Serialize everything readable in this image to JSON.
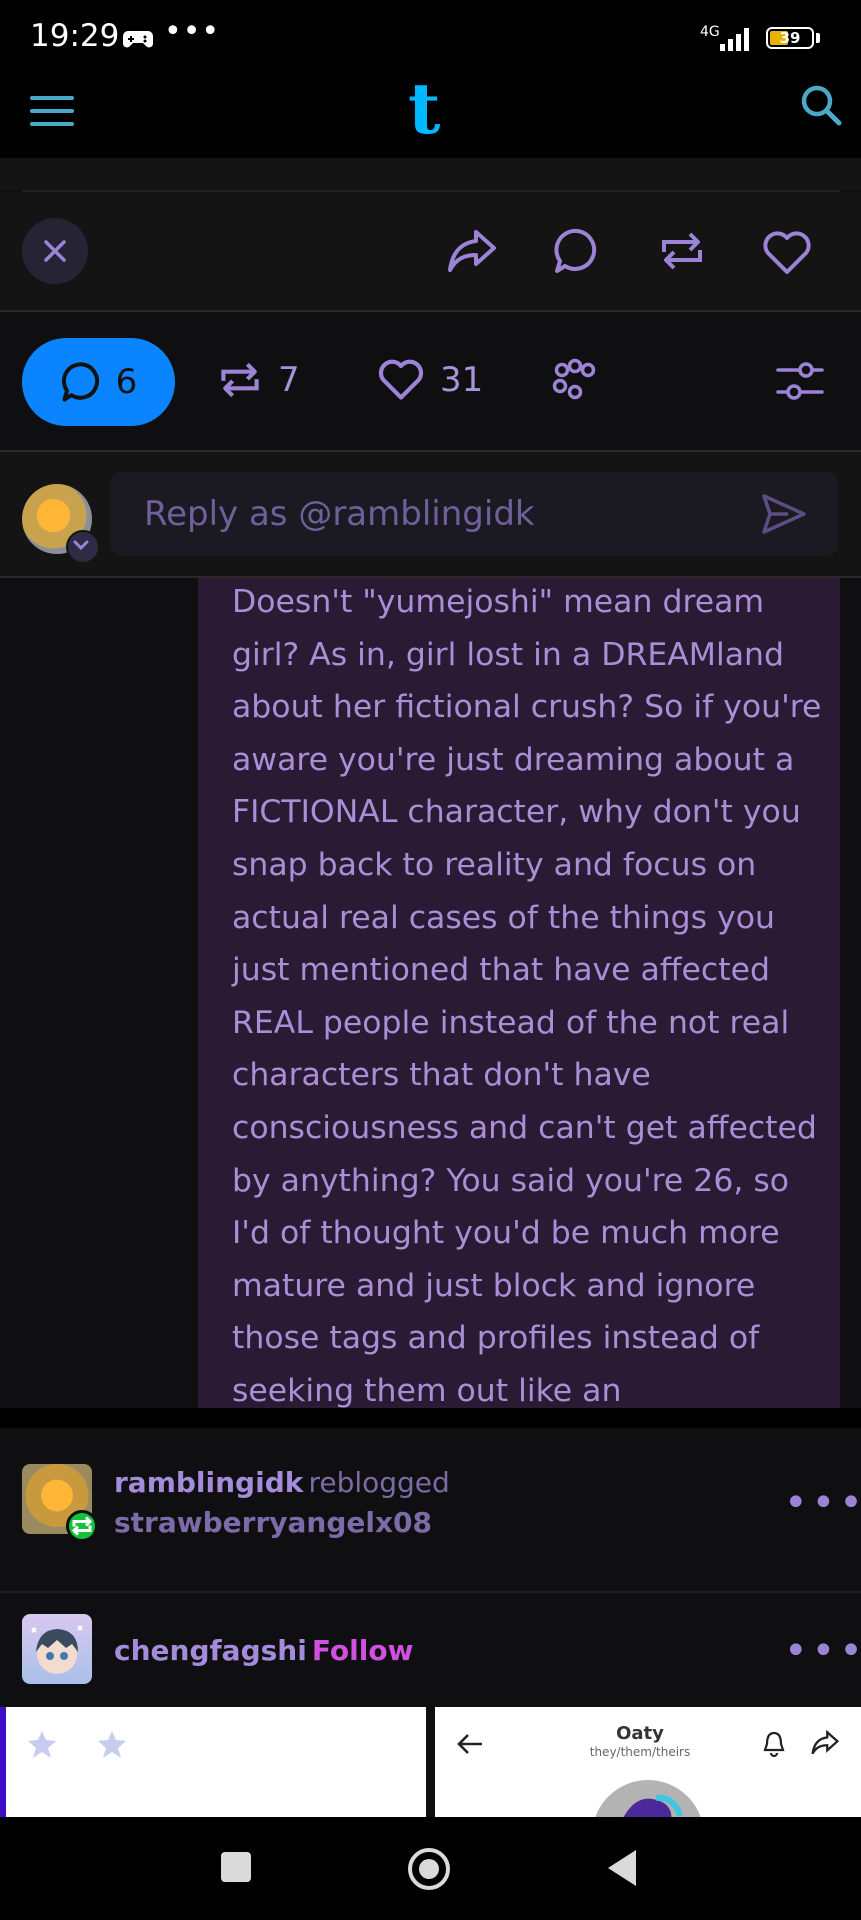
{
  "status_bar": {
    "time": "19:29",
    "dots": "•••",
    "network": "4G",
    "battery": "39"
  },
  "app": {
    "logo": "t"
  },
  "stats": {
    "replies": "6",
    "reblogs": "7",
    "likes": "31"
  },
  "reply": {
    "placeholder": "Reply as @ramblingidk"
  },
  "comment": {
    "text": "Doesn't \"yumejoshi\" mean dream girl? As in, girl lost in a DREAMland about her fictional crush? So if you're aware you're just dreaming about a FICTIONAL character, why don't you snap back to reality and focus on actual real cases of the things you just mentioned that have affected REAL people instead of the not real characters that don't have consciousness and can't get affected by anything? You said you're 26, so I'd  of thought you'd be much more mature and just block and ignore those tags and profiles instead of seeking them out like an"
  },
  "notes": {
    "reblog": {
      "user": "ramblingidk",
      "action": "reblogged",
      "source": "strawberryangelx08"
    },
    "follow": {
      "user": "chengfagshi",
      "action": "Follow"
    }
  },
  "preview": {
    "name": "Oaty",
    "pronouns": "they/them/theirs"
  },
  "colors": {
    "accent": "#0a84ff",
    "purple": "#9b84d6",
    "follow": "#d050e0",
    "reblog_badge": "#13c13a"
  }
}
